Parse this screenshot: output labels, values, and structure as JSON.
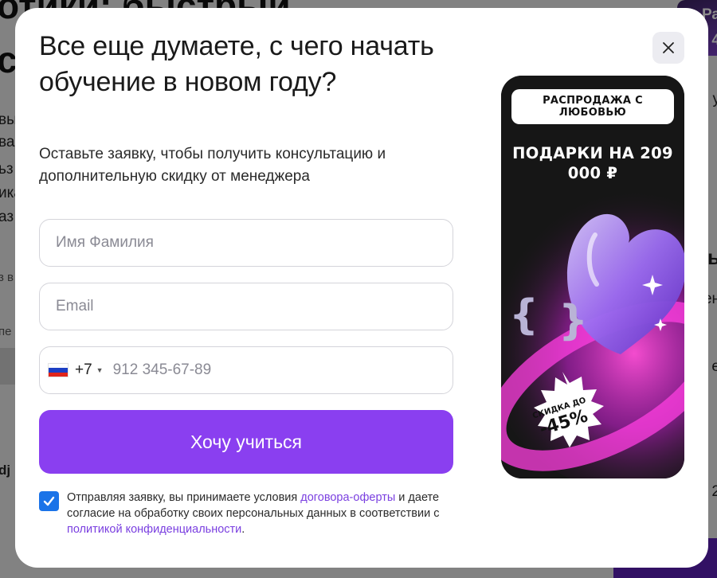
{
  "modal": {
    "title": "Все еще думаете, с чего начать обучение в новом году?",
    "subtitle": "Оставьте заявку, чтобы получить консультацию и дополнительную скидку от менеджера"
  },
  "form": {
    "name_placeholder": "Имя Фамилия",
    "email_placeholder": "Email",
    "phone_code": "+7",
    "phone_placeholder": "912 345-67-89",
    "submit_label": "Хочу учиться"
  },
  "consent": {
    "text_1": "Отправляя заявку, вы принимаете условия ",
    "link_offer": "договора-оферты",
    "text_2": " и даете согласие на обработку своих персональных данных в соответствии с ",
    "link_privacy": "политикой конфиденциальности",
    "text_3": ".",
    "checked": true
  },
  "banner": {
    "pill": "РАСПРОДАЖА С ЛЮБОВЬЮ",
    "headline": "ПОДАРКИ НА 209 000 ₽",
    "badge_small": "СКИДКА ДО",
    "badge_big": "-45%"
  },
  "background": {
    "title_line_1": "отики: быстрый",
    "title_line_2": "си",
    "left_fragments": [
      "вы",
      "ва",
      "ьз",
      "ика",
      "аз",
      "з в",
      "пе",
      "к",
      "dj"
    ],
    "right_fragments": [
      "Ра",
      "4",
      "у",
      "ь",
      "ен",
      "е",
      "2"
    ]
  },
  "colors": {
    "accent": "#8a3ff0",
    "link": "#7a3fe0",
    "checkbox": "#1a73e8"
  }
}
